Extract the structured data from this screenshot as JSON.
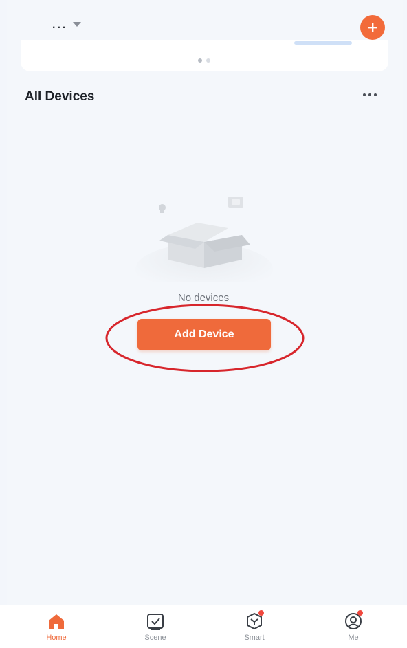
{
  "header": {
    "home_name": "...",
    "caret_icon": "chevron-down-icon",
    "add_icon": "plus-icon",
    "accent_color": "#f26b3a"
  },
  "banner": {
    "page_indicator": {
      "count": 2,
      "active": 0
    }
  },
  "section": {
    "title": "All Devices",
    "more_icon": "more-horizontal-icon"
  },
  "empty_state": {
    "illustration_icon": "empty-box-icon",
    "message": "No devices",
    "action_label": "Add Device",
    "highlight_color": "#d7262c"
  },
  "tabbar": {
    "items": [
      {
        "label": "Home",
        "icon": "home-icon",
        "active": true
      },
      {
        "label": "Scene",
        "icon": "scene-checkbox-icon",
        "active": false
      },
      {
        "label": "Smart",
        "icon": "smart-cube-icon",
        "active": false,
        "badge": true
      },
      {
        "label": "Me",
        "icon": "profile-icon",
        "active": false,
        "badge": true
      }
    ],
    "active_color": "#ef6a3b",
    "inactive_color": "#8d9299"
  }
}
